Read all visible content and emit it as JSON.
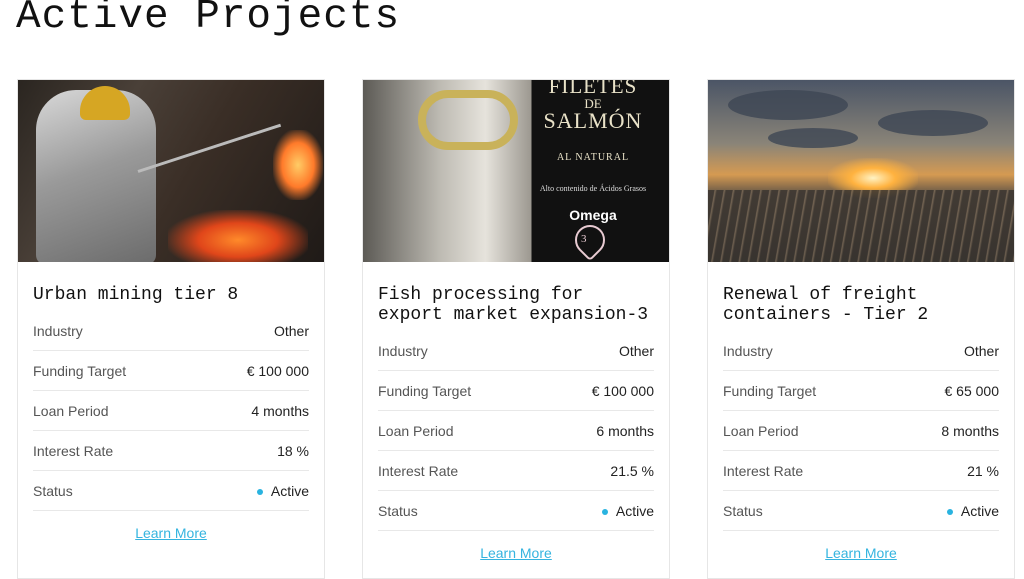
{
  "page": {
    "title": "Active Projects"
  },
  "projects": [
    {
      "title": "Urban mining tier 8",
      "image_icon": "foundry-worker-image",
      "fields": [
        {
          "label": "Industry",
          "value": "Other"
        },
        {
          "label": "Funding Target",
          "value": "€ 100 000"
        },
        {
          "label": "Loan Period",
          "value": "4 months"
        },
        {
          "label": "Interest Rate",
          "value": "18 %"
        },
        {
          "label": "Status",
          "value": "Active"
        }
      ],
      "link": "Learn More"
    },
    {
      "title": "Fish processing for\nexport market expansion-3",
      "image_icon": "salmon-tin-image",
      "image_text": {
        "line1": "FILETES",
        "line2": "DE",
        "line3": "SALMÓN",
        "line4": "AL NATURAL",
        "line5": "Alto contenido de Ácidos Grasos",
        "line6": "Omega",
        "line7": "3"
      },
      "fields": [
        {
          "label": "Industry",
          "value": "Other"
        },
        {
          "label": "Funding Target",
          "value": "€ 100 000"
        },
        {
          "label": "Loan Period",
          "value": "6 months"
        },
        {
          "label": "Interest Rate",
          "value": "21.5 %"
        },
        {
          "label": "Status",
          "value": "Active"
        }
      ],
      "link": "Learn More"
    },
    {
      "title": "Renewal of freight\ncontainers - Tier 2",
      "image_icon": "rail-yard-sunset-image",
      "fields": [
        {
          "label": "Industry",
          "value": "Other"
        },
        {
          "label": "Funding Target",
          "value": "€ 65 000"
        },
        {
          "label": "Loan Period",
          "value": "8 months"
        },
        {
          "label": "Interest Rate",
          "value": "21 %"
        },
        {
          "label": "Status",
          "value": "Active"
        }
      ],
      "link": "Learn More"
    }
  ],
  "colors": {
    "accent": "#29b3e0",
    "link": "#35b4df",
    "status_dot": "#29b3e0"
  }
}
